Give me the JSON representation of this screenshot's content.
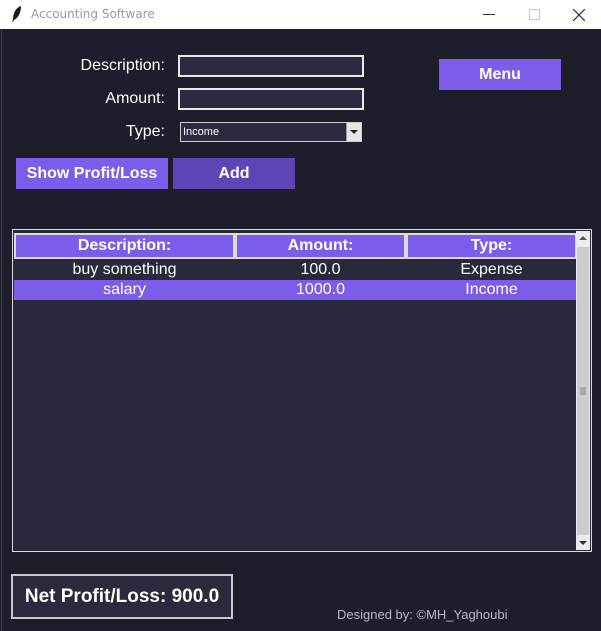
{
  "window": {
    "title": "Accounting Software",
    "icon": "feather-icon"
  },
  "form": {
    "description_label": "Description:",
    "description_value": "",
    "amount_label": "Amount:",
    "amount_value": "",
    "type_label": "Type:",
    "type_selected": "Income"
  },
  "buttons": {
    "menu": "Menu",
    "show_profit_loss": "Show Profit/Loss",
    "add": "Add"
  },
  "table": {
    "columns": [
      "Description:",
      "Amount:",
      "Type:"
    ],
    "rows": [
      {
        "description": "buy something",
        "amount": "100.0",
        "type": "Expense",
        "selected": false
      },
      {
        "description": "salary",
        "amount": "1000.0",
        "type": "Income",
        "selected": true
      }
    ]
  },
  "footer": {
    "net_profit_loss": "Net Profit/Loss: 900.0",
    "credit": "Designed by: ©MH_Yaghoubi"
  },
  "colors": {
    "accent": "#7b5de9",
    "button_dark": "#5e45b5",
    "background": "#1d1d2b",
    "panel": "#29293b"
  }
}
